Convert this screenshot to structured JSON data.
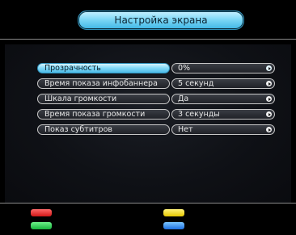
{
  "header": {
    "title": "Настройка экрана"
  },
  "settings": [
    {
      "label": "Прозрачность",
      "value": "0%"
    },
    {
      "label": "Время показа инфобаннера",
      "value": "5 секунд"
    },
    {
      "label": "Шкала громкости",
      "value": "Да"
    },
    {
      "label": "Время показа громкости",
      "value": "3 секунды"
    },
    {
      "label": "Показ субтитров",
      "value": "Нет"
    }
  ],
  "colors": {
    "accent": "#7fd8f6",
    "red_key": "#e02020",
    "green_key": "#20c040",
    "yellow_key": "#f0d800",
    "blue_key": "#2a80e8"
  },
  "icons": {
    "value_arrow": "chevron-right-icon"
  }
}
